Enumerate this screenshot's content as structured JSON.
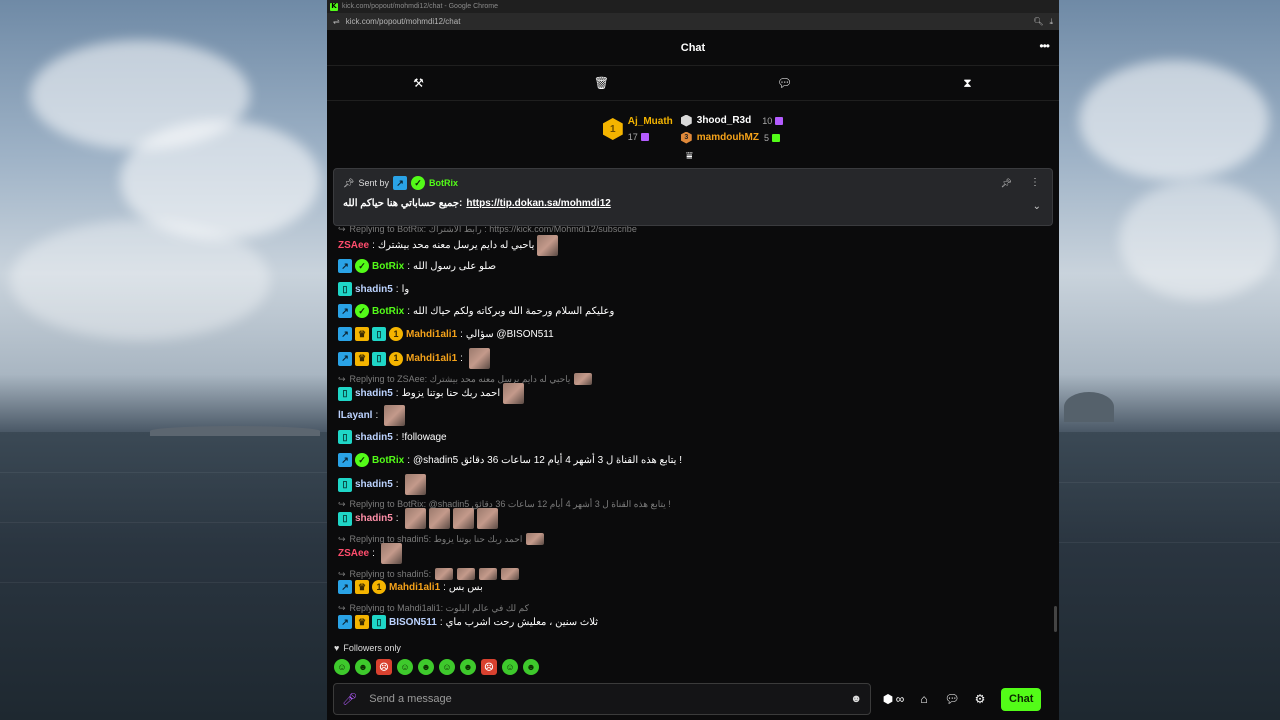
{
  "browser": {
    "title": "kick.com/popout/mohmdi12/chat - Google Chrome",
    "url": "kick.com/popout/mohmdi12/chat"
  },
  "header": {
    "title": "Chat"
  },
  "leaderboard": {
    "first": {
      "rank": "1",
      "name": "Aj_Muath",
      "count": "17"
    },
    "second": {
      "name": "3hood_R3d",
      "count": "10"
    },
    "third": {
      "rank": "3",
      "name": "mamdouhMZ",
      "count": "5"
    }
  },
  "pinned": {
    "sent_by_label": "Sent by",
    "author": "BotRix",
    "text": "جميع حساباتي هنا حياكم الله:",
    "link": "https://tip.dokan.sa/mohmdi12"
  },
  "messages": [
    {
      "reply": "Replying to BotRix: رابط الاشتراك : https://kick.com/Mohmdi12/subscribe"
    },
    {
      "user": "ZSAee",
      "color": "#ff4d6d",
      "text": "ياحبي له دايم يرسل معنه محد بيشترك"
    },
    {
      "user": "BotRix",
      "color": "#53fc18",
      "text": "صلو على رسول الله"
    },
    {
      "user": "shadin5",
      "color": "#bcd3ff",
      "text": "وا"
    },
    {
      "user": "BotRix",
      "color": "#53fc18",
      "text": "وعليكم السلام ورحمة الله وبركاته ولكم حياك الله"
    },
    {
      "user": "Mahdi1ali1",
      "color": "#f4a21a",
      "text": "سؤالي @BISON511"
    },
    {
      "user": "Mahdi1ali1",
      "color": "#f4a21a",
      "text": ""
    },
    {
      "reply": "Replying to ZSAee: ياحبي له دايم يرسل معنه محد بيشترك"
    },
    {
      "user": "shadin5",
      "color": "#bcd3ff",
      "text": "احمد ربك حنا بوتنا يزوط"
    },
    {
      "user": "lLayanl",
      "color": "#bcd3ff",
      "text": ""
    },
    {
      "user": "shadin5",
      "color": "#bcd3ff",
      "text": "!followage"
    },
    {
      "user": "BotRix",
      "color": "#53fc18",
      "text": "@shadin5 يتابع هذه القناة ل 3 أشهر 4 أيام 12 ساعات 36 دقائق !"
    },
    {
      "user": "shadin5",
      "color": "#bcd3ff",
      "text": ""
    },
    {
      "reply": "Replying to BotRix: @shadin5 يتابع هذه القناة ل 3 أشهر 4 أيام 12 ساعات 36 دقائق !"
    },
    {
      "user": "shadin5",
      "color": "#ff8fa8",
      "text": ""
    },
    {
      "reply": "Replying to shadin5: احمد ربك حنا بوتنا يزوط"
    },
    {
      "user": "ZSAee",
      "color": "#ff4d6d",
      "text": ""
    },
    {
      "reply": "Replying to shadin5:"
    },
    {
      "user": "Mahdi1ali1",
      "color": "#f4a21a",
      "text": "بس بس"
    },
    {
      "reply": "Replying to Mahdi1ali1: كم لك في عالم البلوت"
    },
    {
      "user": "BISON511",
      "color": "#bcd3ff",
      "text": "ثلاث سنين ، معليش رحت اشرب ماي"
    }
  ],
  "footer": {
    "followers_only": "Followers only",
    "placeholder": "Send a message",
    "chat_button": "Chat",
    "points": "∞"
  },
  "colors": {
    "accent": "#53fc18",
    "background": "#0b0b0c"
  }
}
